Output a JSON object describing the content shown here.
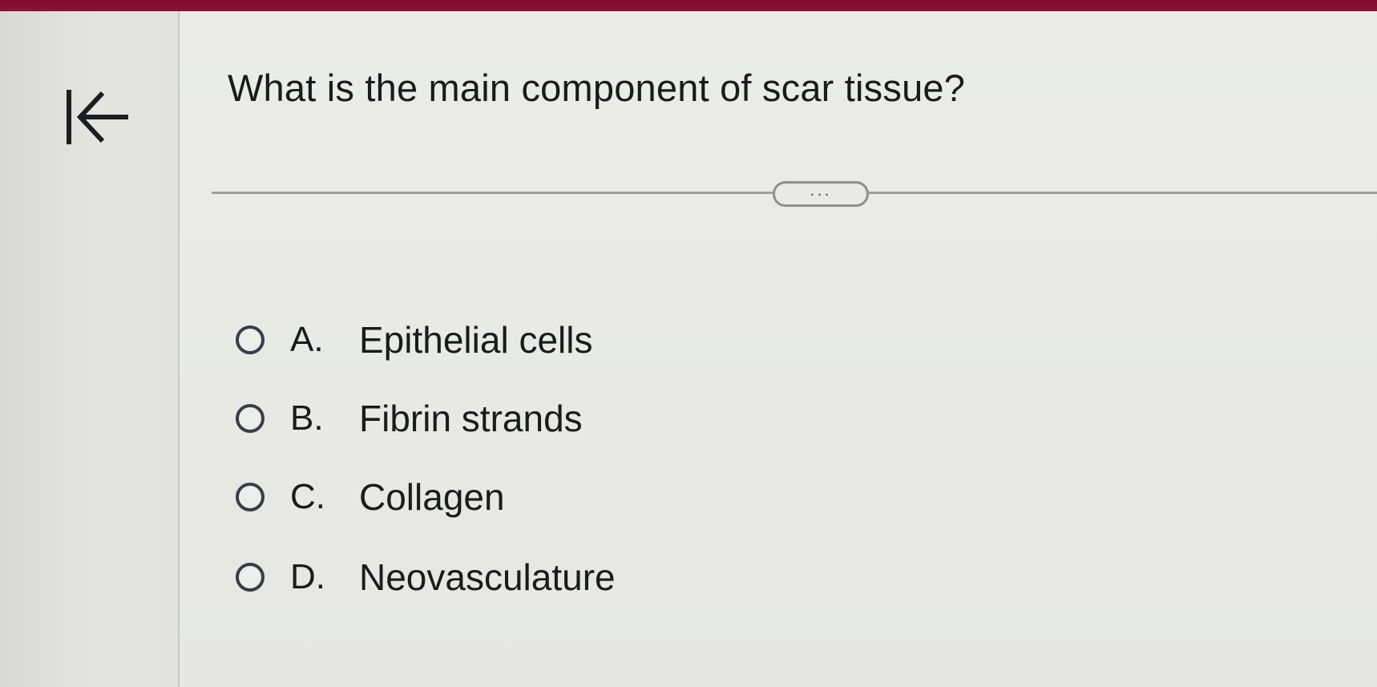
{
  "question": {
    "text": "What is the main component of scar tissue?"
  },
  "expand_button": {
    "label": "..."
  },
  "options": [
    {
      "letter": "A.",
      "text": "Epithelial cells",
      "selected": false
    },
    {
      "letter": "B.",
      "text": "Fibrin strands",
      "selected": false
    },
    {
      "letter": "C.",
      "text": "Collagen",
      "selected": false
    },
    {
      "letter": "D.",
      "text": "Neovasculature",
      "selected": false
    }
  ],
  "icons": {
    "back": "collapse-left-arrow-icon"
  },
  "colors": {
    "top_bar": "#8e1238",
    "background": "#e6e7e3",
    "text": "#1a1b1d",
    "radio_border": "#3a3d47"
  }
}
